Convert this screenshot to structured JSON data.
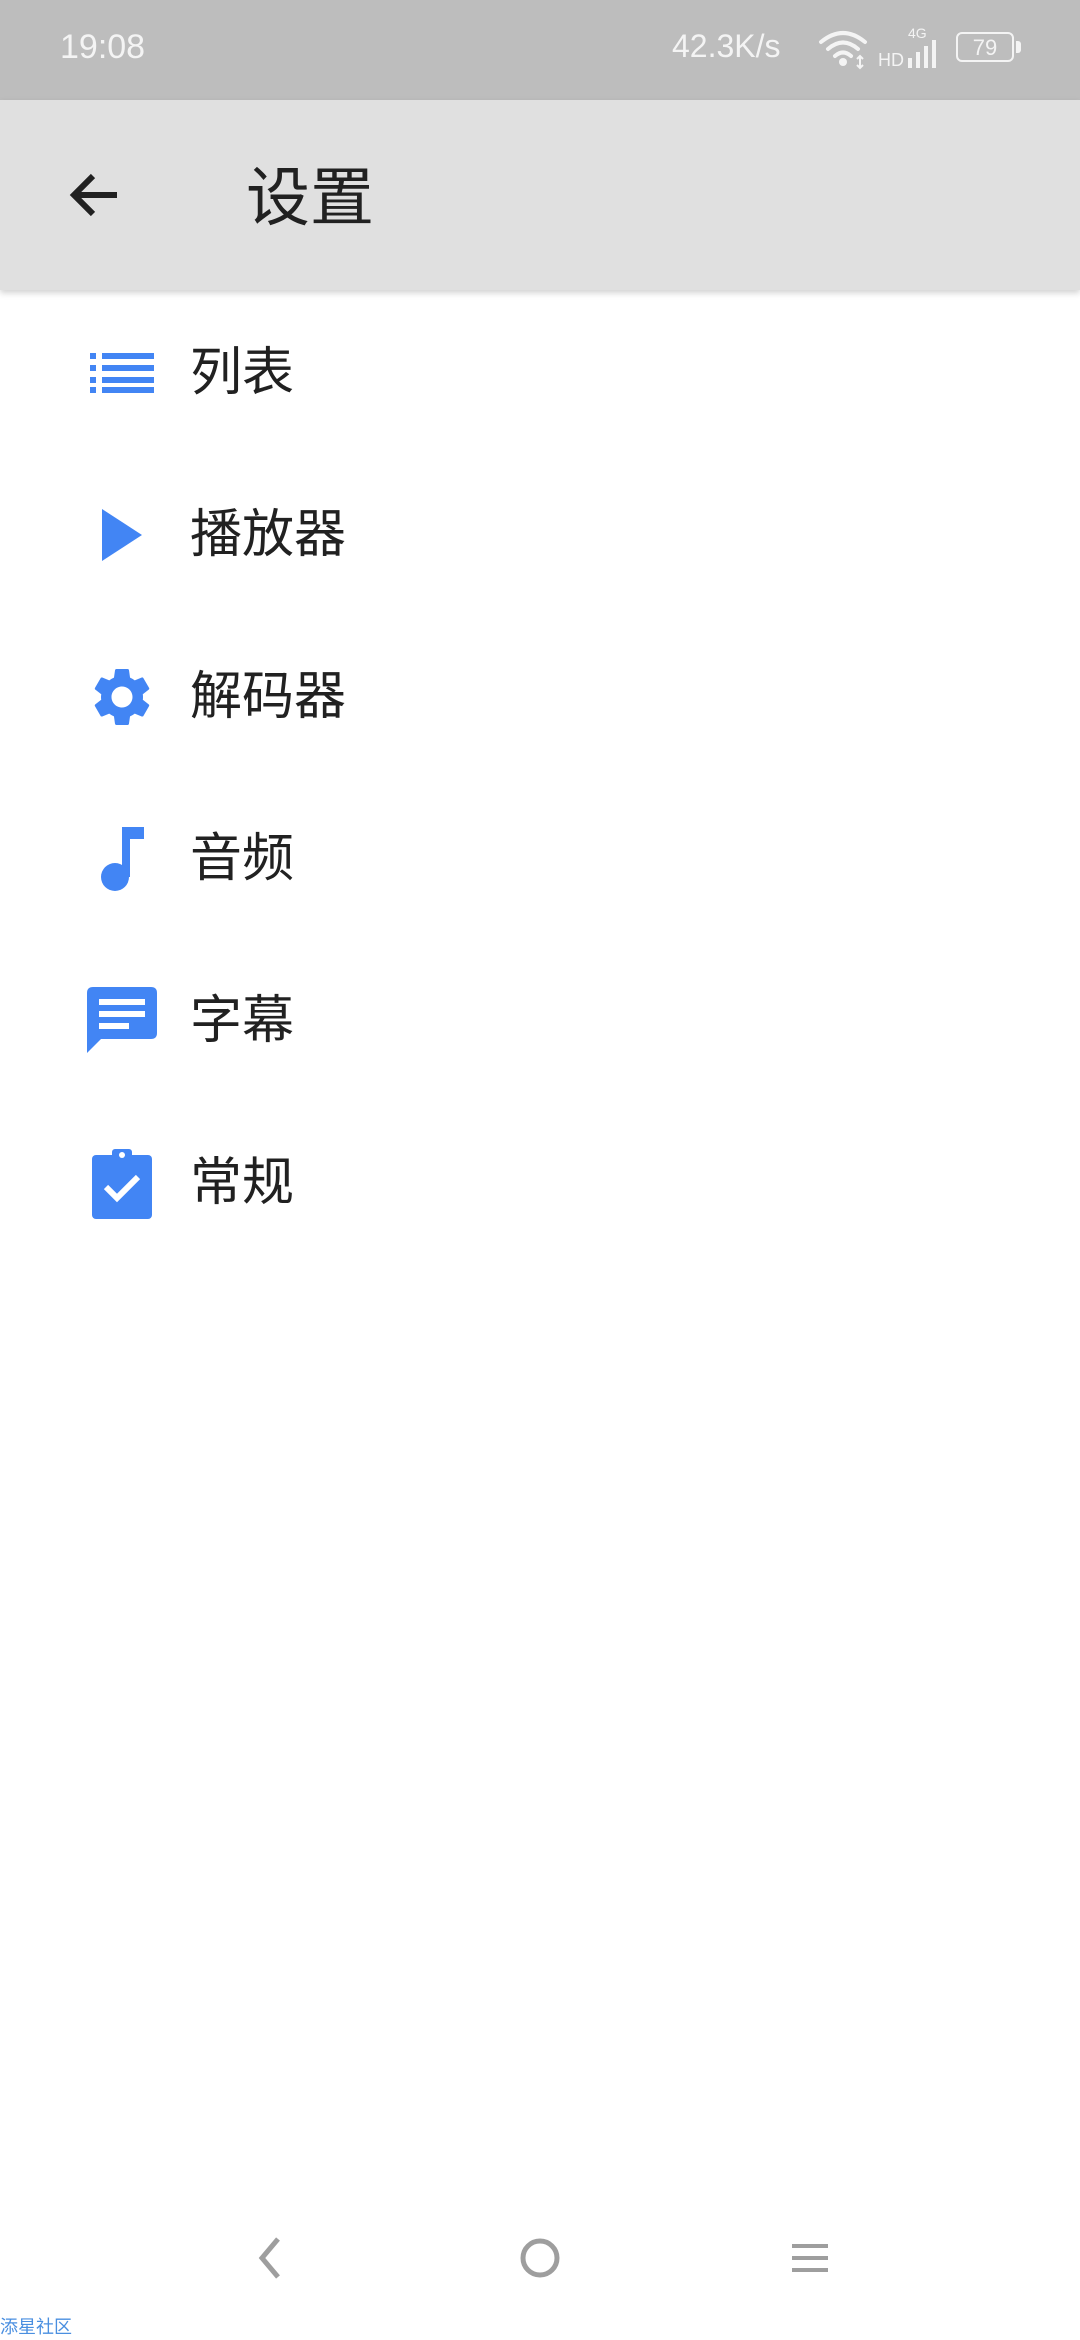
{
  "status_bar": {
    "time": "19:08",
    "network_speed": "42.3K/s",
    "network_type": "4G",
    "hd_label": "HD",
    "battery_level": "79"
  },
  "header": {
    "title": "设置"
  },
  "menu": {
    "items": [
      {
        "label": "列表",
        "icon": "list-icon"
      },
      {
        "label": "播放器",
        "icon": "play-icon"
      },
      {
        "label": "解码器",
        "icon": "gear-icon"
      },
      {
        "label": "音频",
        "icon": "music-note-icon"
      },
      {
        "label": "字幕",
        "icon": "subtitles-icon"
      },
      {
        "label": "常规",
        "icon": "clipboard-check-icon"
      }
    ]
  },
  "colors": {
    "accent": "#4285F4",
    "app_bar": "#E0E0E0",
    "status_bar": "#BDBDBD",
    "text": "#212121"
  },
  "watermark": {
    "text": "添星社区"
  }
}
